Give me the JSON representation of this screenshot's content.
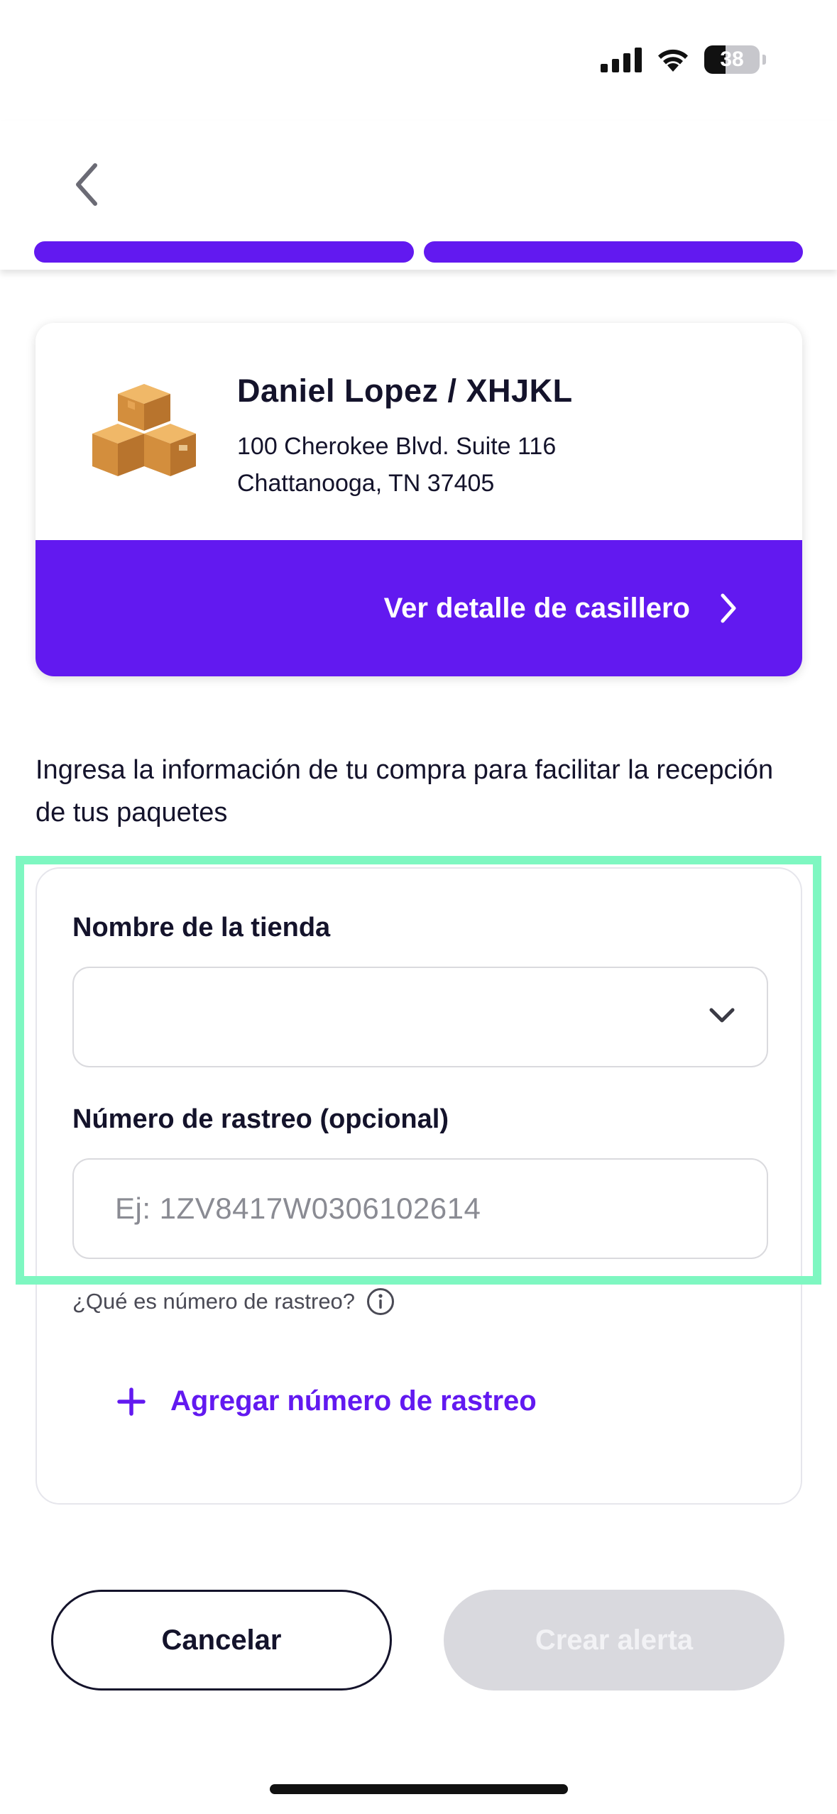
{
  "status_bar": {
    "battery_percent": "38",
    "battery_level": 0.38,
    "icons": [
      "signal-icon",
      "wifi-icon",
      "battery-icon"
    ]
  },
  "header": {
    "back_icon": "chevron-left-icon",
    "progress_steps_total": 2,
    "progress_steps_complete": 2,
    "accent_color": "#6219f0"
  },
  "address_card": {
    "icon": "boxes-icon",
    "name": "Daniel Lopez / XHJKL",
    "address_line1": "100 Cherokee Blvd. Suite 116",
    "address_line2": "Chattanooga, TN 37405",
    "cta_label": "Ver detalle de casillero",
    "cta_icon": "chevron-right-icon"
  },
  "intro_text": "Ingresa la información de tu compra para facilitar la recepción de tus paquetes",
  "form": {
    "store_label": "Nombre de la tienda",
    "store_value": "",
    "store_icon": "chevron-down-icon",
    "tracking_label": "Número de rastreo (opcional)",
    "tracking_placeholder": "Ej: 1ZV8417W0306102614",
    "help_text": "¿Qué es número de rastreo?",
    "help_icon": "info-icon",
    "add_tracking_label": "Agregar número de rastreo",
    "add_icon": "plus-icon"
  },
  "highlight_color": "#7ef7c1",
  "actions": {
    "cancel_label": "Cancelar",
    "create_label": "Crear alerta",
    "create_disabled": true
  }
}
